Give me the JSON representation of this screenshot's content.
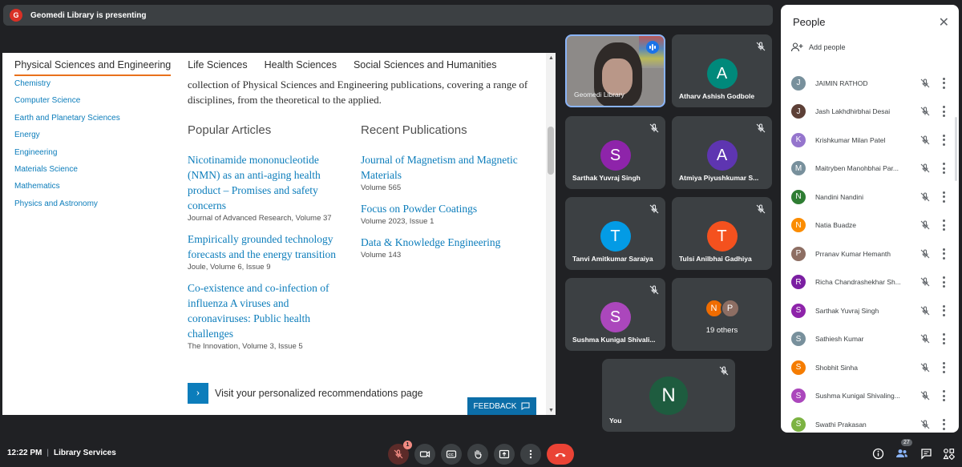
{
  "presenter": {
    "avatar_letter": "G",
    "avatar_color": "#d93025",
    "text": "Geomedi Library is presenting"
  },
  "screen": {
    "tabs": [
      {
        "label": "Physical Sciences and Engineering",
        "active": true
      },
      {
        "label": "Life Sciences",
        "active": false
      },
      {
        "label": "Health Sciences",
        "active": false
      },
      {
        "label": "Social Sciences and Humanities",
        "active": false
      }
    ],
    "subjects": [
      "Chemistry",
      "Computer Science",
      "Earth and Planetary Sciences",
      "Energy",
      "Engineering",
      "Materials Science",
      "Mathematics",
      "Physics and Astronomy"
    ],
    "intro": "collection of Physical Sciences and Engineering publications, covering a range of disciplines, from the theoretical to the applied.",
    "popular_heading": "Popular Articles",
    "recent_heading": "Recent Publications",
    "articles": [
      {
        "title": "Nicotinamide mononucleotide (NMN) as an anti-aging health product – Promises and safety concerns",
        "meta": "Journal of Advanced Research, Volume 37"
      },
      {
        "title": "Empirically grounded technology forecasts and the energy transition",
        "meta": "Joule, Volume 6, Issue 9"
      },
      {
        "title": "Co-existence and co-infection of influenza A viruses and coronaviruses: Public health challenges",
        "meta": "The Innovation, Volume 3, Issue 5"
      }
    ],
    "publications": [
      {
        "title": "Journal of Magnetism and Magnetic Materials",
        "meta": "Volume 565"
      },
      {
        "title": "Focus on Powder Coatings",
        "meta": "Volume 2023, Issue 1"
      },
      {
        "title": "Data & Knowledge Engineering",
        "meta": "Volume 143"
      }
    ],
    "recs_text": "Visit your personalized recommendations page",
    "feedback_label": "FEEDBACK"
  },
  "tiles": {
    "self_video_name": "Geomedi Library",
    "atharv": {
      "letter": "A",
      "color": "#00897b",
      "name": "Atharv Ashish Godbole"
    },
    "sarthak": {
      "letter": "S",
      "color": "#8e24aa",
      "name": "Sarthak Yuvraj Singh"
    },
    "atmiya": {
      "letter": "A",
      "color": "#5e35b1",
      "name": "Atmiya Piyushkumar S..."
    },
    "tanvi": {
      "letter": "T",
      "color": "#039be5",
      "name": "Tanvi Amitkumar Saraiya"
    },
    "tulsi": {
      "letter": "T",
      "color": "#f4511e",
      "name": "Tulsi Anilbhai Gadhiya"
    },
    "sushma": {
      "letter": "S",
      "color": "#ab47bc",
      "name": "Sushma Kunigal Shivali..."
    },
    "others": {
      "letters": [
        "N",
        "P"
      ],
      "colors": [
        "#ef6c00",
        "#8d6e63"
      ],
      "label": "19 others"
    },
    "you": {
      "letter": "N",
      "color": "#1e5c3f",
      "name": "You"
    }
  },
  "people": {
    "title": "People",
    "add_label": "Add people",
    "list": [
      {
        "letter": "J",
        "color": "#78909c",
        "name": "JAIMIN RATHOD"
      },
      {
        "letter": "J",
        "color": "#5d4037",
        "name": "Jash Lakhdhirbhai Desai"
      },
      {
        "letter": "K",
        "color": "#9575cd",
        "name": "Krishkumar Milan Patel"
      },
      {
        "letter": "M",
        "color": "#78909c",
        "name": "Maitryben Manohbhai Par..."
      },
      {
        "letter": "N",
        "color": "#2e7d32",
        "name": "Nandini Nandini"
      },
      {
        "letter": "N",
        "color": "#fb8c00",
        "name": "Natia Buadze"
      },
      {
        "letter": "P",
        "color": "#8d6e63",
        "name": "Prranav Kumar Hemanth"
      },
      {
        "letter": "R",
        "color": "#7b1fa2",
        "name": "Richa Chandrashekhar Sh..."
      },
      {
        "letter": "S",
        "color": "#8e24aa",
        "name": "Sarthak Yuvraj Singh"
      },
      {
        "letter": "S",
        "color": "#78909c",
        "name": "Sathiesh Kumar"
      },
      {
        "letter": "S",
        "color": "#f57c00",
        "name": "Shobhit Sinha"
      },
      {
        "letter": "S",
        "color": "#ab47bc",
        "name": "Sushma Kunigal Shivaling..."
      },
      {
        "letter": "S",
        "color": "#7cb342",
        "name": "Swathi Prakasan"
      }
    ]
  },
  "bottom": {
    "time": "12:22 PM",
    "meeting_name": "Library Services",
    "notification_count": "1",
    "people_count": "27"
  }
}
